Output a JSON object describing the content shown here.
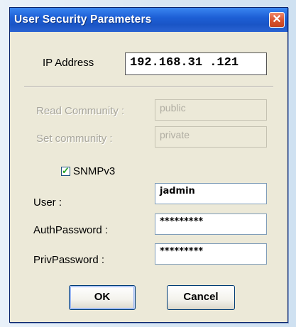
{
  "window": {
    "title": "User Security Parameters"
  },
  "ip": {
    "label": "IP Address",
    "value": "192.168.31 .121"
  },
  "read_community": {
    "label": "Read Community :",
    "value": "public"
  },
  "set_community": {
    "label": "Set community :",
    "value": "private"
  },
  "snmpv3": {
    "label": "SNMPv3",
    "checked": true
  },
  "user": {
    "label": "User :",
    "value": "jadmin"
  },
  "auth_password": {
    "label": "AuthPassword :",
    "value": "*********"
  },
  "priv_password": {
    "label": "PrivPassword :",
    "value": "*********"
  },
  "buttons": {
    "ok": "OK",
    "cancel": "Cancel"
  },
  "colors": {
    "titlebar": "#1d5fd6",
    "dialog": "#ece9d8",
    "close": "#d8532e"
  },
  "icons": {
    "close": "close-icon",
    "check": "checkmark-icon"
  }
}
